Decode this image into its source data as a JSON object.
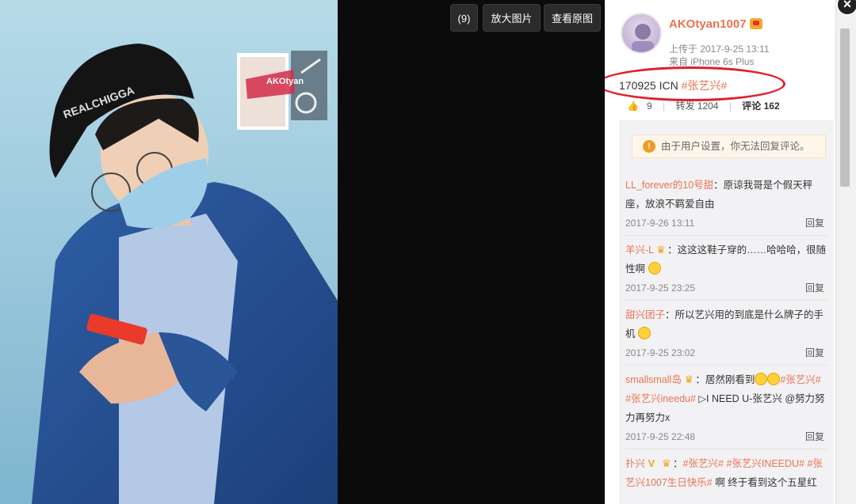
{
  "toolbar": {
    "count_label": "(9)",
    "zoom_label": "放大图片",
    "original_label": "查看原图"
  },
  "photo": {
    "cap_text": "REALCHIGGA",
    "watermark_text": "AKOtyan"
  },
  "post": {
    "username": "AKOtyan1007",
    "upload_time": "上传于 2017-9-25 13:11",
    "source": "来自 iPhone 6s Plus",
    "text_prefix": "170925 ICN ",
    "text_tag": "#张艺兴#",
    "likes": "9",
    "reposts": "转发 1204",
    "comments": "评论 162"
  },
  "notice": {
    "text": "由于用户设置，你无法回复评论。"
  },
  "comments": [
    {
      "user": "LL_forever的10号甜",
      "text": "：原谅我哥是个假天秤座，放浪不羁爱自由",
      "time": "2017-9-26 13:11",
      "reply": "回复"
    },
    {
      "user": "羊兴-L",
      "text": "：这这这鞋子穿的……哈哈哈，很随性啊",
      "time": "2017-9-25 23:25",
      "reply": "回复"
    },
    {
      "user": "甜兴团子",
      "text": "：所以艺兴用的到底是什么牌子的手机",
      "time": "2017-9-25 23:02",
      "reply": "回复"
    },
    {
      "user": "smallsmall岛",
      "text": "：居然刚看到",
      "tags": "#张艺兴# #张艺兴ineedu#",
      "text2": " ▷I NEED U-张艺兴 @努力努力再努力x",
      "time": "2017-9-25 22:48",
      "reply": "回复"
    },
    {
      "user": "扑兴",
      "tags": "#张艺兴# #张艺兴INEEDU# #张艺兴1007生日快乐#",
      "text": " 啊 终于看到这个五星红"
    }
  ],
  "colors": {
    "accent": "#eb7350",
    "highlight_circle": "#e0202a",
    "notice_bg": "#fef6ea"
  },
  "icons": [
    "close-icon",
    "like-icon",
    "warning-icon",
    "phone-icon"
  ]
}
